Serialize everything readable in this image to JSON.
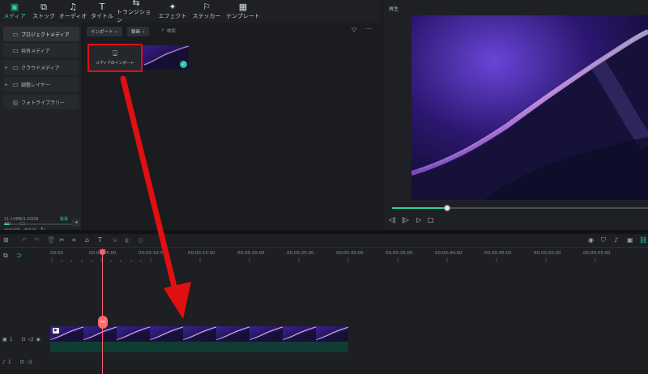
{
  "colors": {
    "accent": "#2ad0a8",
    "highlight_box": "#e01010",
    "arrow": "#e01010",
    "playhead": "#ff5d6c"
  },
  "toolbar": {
    "tabs": [
      {
        "label": "メディア",
        "icon": "media-icon",
        "active": true
      },
      {
        "label": "ストック",
        "icon": "stock-icon"
      },
      {
        "label": "オーディオ",
        "icon": "music-icon"
      },
      {
        "label": "タイトル",
        "icon": "title-icon"
      },
      {
        "label": "トランジション",
        "icon": "transition-icon"
      },
      {
        "label": "エフェクト",
        "icon": "effect-icon"
      },
      {
        "label": "ステッカー",
        "icon": "sticker-icon"
      },
      {
        "label": "テンプレート",
        "icon": "template-icon"
      }
    ]
  },
  "sidebar": {
    "items": [
      {
        "label": "プロジェクトメディア",
        "active": true
      },
      {
        "label": "共有メディア"
      },
      {
        "label": "クラウドメディア"
      },
      {
        "label": "調整レイヤー"
      },
      {
        "label": "フォトライブラリー"
      }
    ],
    "storage": {
      "usage": "11.14MB/1.00GB",
      "upgrade_label": "拡張",
      "sub_label": "使用状態・無料版",
      "fill_fraction": 0.06
    }
  },
  "media": {
    "import_dropdown": "インポート",
    "record_dropdown": "録画",
    "search_placeholder": "検索",
    "import_card_label": "メディアのインポート"
  },
  "preview": {
    "title": "再生"
  },
  "timeline": {
    "ruler_labels": [
      "00:00",
      "00:00:05:00",
      "00:00:10:00",
      "00:00:15:00",
      "00:00:20:00",
      "00:00:25:00",
      "00:00:30:00",
      "00:00:35:00",
      "00:00:40:00",
      "00:00:45:00",
      "00:00:50:00",
      "00:00:55:00"
    ],
    "video_track_label": "1",
    "audio_track_label": "1"
  }
}
